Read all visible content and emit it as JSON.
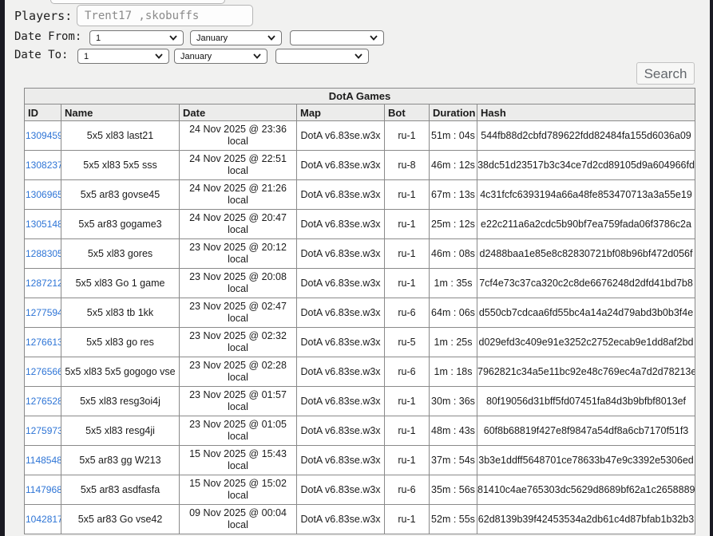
{
  "form": {
    "players_label": "Players:",
    "players_value": "Trent17 ,skobuffs",
    "date_from_label": "Date From:",
    "date_to_label": "Date To:",
    "date_from": {
      "day": "1",
      "month": "January",
      "year": ""
    },
    "date_to": {
      "day": "1",
      "month": "January",
      "year": ""
    },
    "search_label": "Search"
  },
  "table": {
    "title": "DotA Games",
    "columns": [
      "ID",
      "Name",
      "Date",
      "Map",
      "Bot",
      "Duration",
      "Hash"
    ],
    "rows": [
      {
        "id": "1309459",
        "name": "5x5 xl83 last21",
        "date": "24 Nov 2025 @ 23:36",
        "date_local": "local",
        "map": "DotA v6.83se.w3x",
        "bot": "ru-1",
        "duration": "51m : 04s",
        "hash": "544fb88d2cbfd789622fdd82484fa155d6036a09"
      },
      {
        "id": "1308237",
        "name": "5x5 xl83 5x5 sss",
        "date": "24 Nov 2025 @ 22:51",
        "date_local": "local",
        "map": "DotA v6.83se.w3x",
        "bot": "ru-8",
        "duration": "46m : 12s",
        "hash": "38dc51d23517b3c34ce7d2cd89105d9a604966fd"
      },
      {
        "id": "1306965",
        "name": "5x5 ar83 govse45",
        "date": "24 Nov 2025 @ 21:26",
        "date_local": "local",
        "map": "DotA v6.83se.w3x",
        "bot": "ru-1",
        "duration": "67m : 13s",
        "hash": "4c31fcfc6393194a66a48fe853470713a3a55e19"
      },
      {
        "id": "1305148",
        "name": "5x5 ar83 gogame3",
        "date": "24 Nov 2025 @ 20:47",
        "date_local": "local",
        "map": "DotA v6.83se.w3x",
        "bot": "ru-1",
        "duration": "25m : 12s",
        "hash": "e22c211a6a2cdc5b90bf7ea759fada06f3786c2a"
      },
      {
        "id": "1288305",
        "name": "5x5 xl83 gores",
        "date": "23 Nov 2025 @ 20:12",
        "date_local": "local",
        "map": "DotA v6.83se.w3x",
        "bot": "ru-1",
        "duration": "46m : 08s",
        "hash": "d2488baa1e85e8c82830721bf08b96bf472d056f"
      },
      {
        "id": "1287212",
        "name": "5x5 xl83 Go 1 game",
        "date": "23 Nov 2025 @ 20:08",
        "date_local": "local",
        "map": "DotA v6.83se.w3x",
        "bot": "ru-1",
        "duration": "1m : 35s",
        "hash": "7cf4e73c37ca320c2c8de6676248d2dfd41bd7b8"
      },
      {
        "id": "1277594",
        "name": "5x5 xl83 tb 1kk",
        "date": "23 Nov 2025 @ 02:47",
        "date_local": "local",
        "map": "DotA v6.83se.w3x",
        "bot": "ru-6",
        "duration": "64m : 06s",
        "hash": "d550cb7cdcaa6fd55bc4a14a24d79abd3b0b3f4e"
      },
      {
        "id": "1276613",
        "name": "5x5 xl83 go res",
        "date": "23 Nov 2025 @ 02:32",
        "date_local": "local",
        "map": "DotA v6.83se.w3x",
        "bot": "ru-5",
        "duration": "1m : 25s",
        "hash": "d029efd3c409e91e3252c2752ecab9e1dd8af2bd"
      },
      {
        "id": "1276566",
        "name": "5x5 xl83 5x5 gogogo vse",
        "date": "23 Nov 2025 @ 02:28",
        "date_local": "local",
        "map": "DotA v6.83se.w3x",
        "bot": "ru-6",
        "duration": "1m : 18s",
        "hash": "7962821c34a5e11bc92e48c769ec4a7d2d78213e"
      },
      {
        "id": "1276528",
        "name": "5x5 xl83 resg3oi4j",
        "date": "23 Nov 2025 @ 01:57",
        "date_local": "local",
        "map": "DotA v6.83se.w3x",
        "bot": "ru-1",
        "duration": "30m : 36s",
        "hash": "80f19056d31bff5fd07451fa84d3b9bfbf8013ef"
      },
      {
        "id": "1275973",
        "name": "5x5 xl83 resg4ji",
        "date": "23 Nov 2025 @ 01:05",
        "date_local": "local",
        "map": "DotA v6.83se.w3x",
        "bot": "ru-1",
        "duration": "48m : 43s",
        "hash": "60f8b68819f427e8f9847a54df8a6cb7170f51f3"
      },
      {
        "id": "1148548",
        "name": "5x5 ar83 gg W213",
        "date": "15 Nov 2025 @ 15:43",
        "date_local": "local",
        "map": "DotA v6.83se.w3x",
        "bot": "ru-1",
        "duration": "37m : 54s",
        "hash": "3b3e1ddff5648701ce78633b47e9c3392e5306ed"
      },
      {
        "id": "1147968",
        "name": "5x5 ar83 asdfasfa",
        "date": "15 Nov 2025 @ 15:02",
        "date_local": "local",
        "map": "DotA v6.83se.w3x",
        "bot": "ru-6",
        "duration": "35m : 56s",
        "hash": "81410c4ae765303dc5629d8689bf62a1c2658889"
      },
      {
        "id": "1042817",
        "name": "5x5 ar83 Go vse42",
        "date": "09 Nov 2025 @ 00:04",
        "date_local": "local",
        "map": "DotA v6.83se.w3x",
        "bot": "ru-1",
        "duration": "52m : 55s",
        "hash": "62d8139b39f42453534a2db61c4d87bfab1b32b3"
      }
    ]
  },
  "colors": {
    "page_bg": "#f1f1f0",
    "edge_dark": "#1a1a22",
    "header_bg": "#ececeb",
    "table_border": "#8a8a8a",
    "link_blue": "#2d74d6"
  }
}
